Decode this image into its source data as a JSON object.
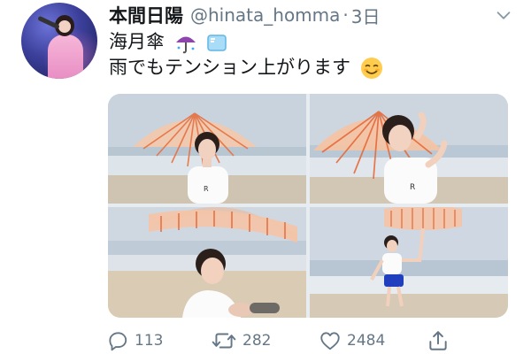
{
  "tweet": {
    "display_name": "本間日陽",
    "handle": "@hinata_homma",
    "separator": "·",
    "timestamp": "3日",
    "text_line1": "海月傘",
    "text_line1_emojis": [
      "umbrella-with-rain-icon",
      "ice-cube-icon"
    ],
    "text_line2": "雨でもテンション上がります",
    "text_line2_emoji": "smiling-face-icon"
  },
  "media": {
    "photos": [
      {
        "subject": "woman under jellyfish umbrella on beach"
      },
      {
        "subject": "woman smiling under jellyfish umbrella"
      },
      {
        "subject": "woman crouching on sand with umbrella"
      },
      {
        "subject": "woman walking on beach holding umbrella"
      }
    ]
  },
  "actions": {
    "reply_count": "113",
    "retweet_count": "282",
    "like_count": "2484"
  },
  "colors": {
    "text": "#14171a",
    "secondary": "#657786",
    "umbrella": "#f08a5d"
  }
}
